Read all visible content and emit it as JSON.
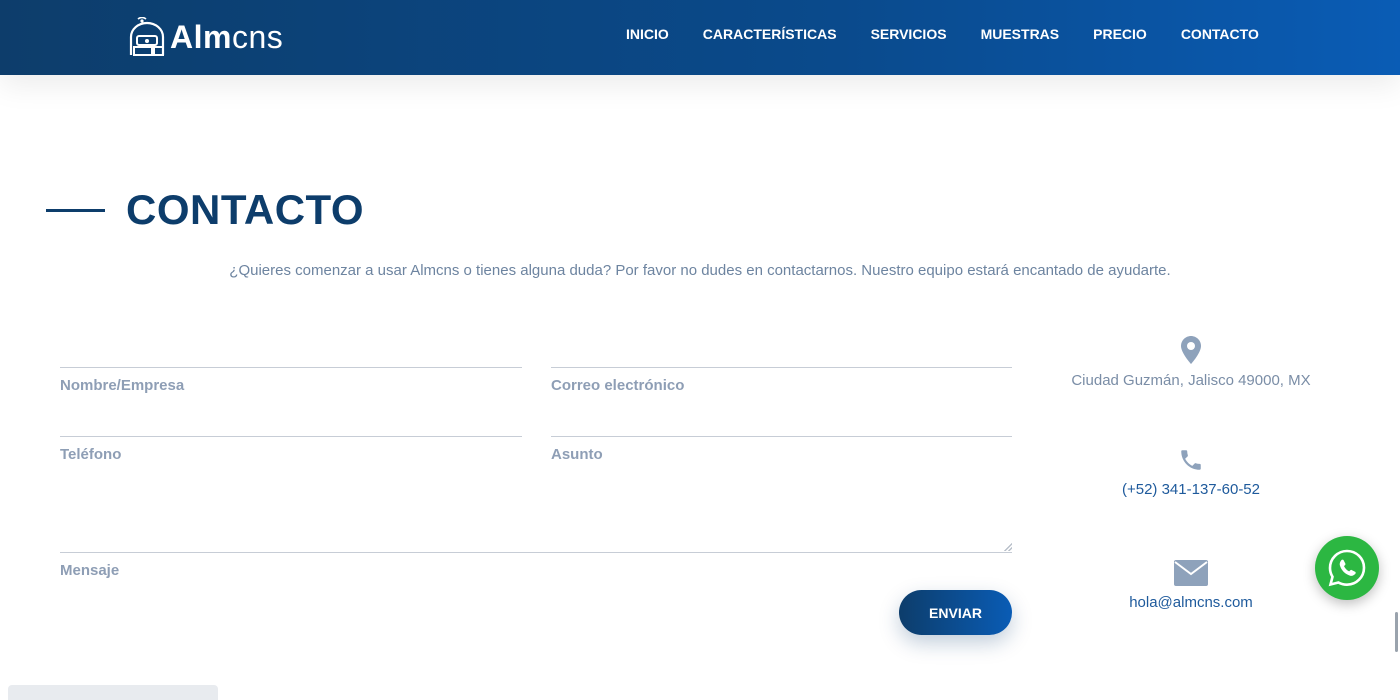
{
  "brand": {
    "logo_bold": "Alm",
    "logo_light": "cns"
  },
  "nav": [
    "INICIO",
    "CARACTERÍSTICAS",
    "SERVICIOS",
    "MUESTRAS",
    "PRECIO",
    "CONTACTO"
  ],
  "section": {
    "title": "CONTACTO",
    "intro": "¿Quieres comenzar a usar Almcns o tienes alguna duda? Por favor no dudes en contactarnos. Nuestro equipo estará encantado de ayudarte."
  },
  "form": {
    "name_label": "Nombre/Empresa",
    "email_label": "Correo electrónico",
    "phone_label": "Teléfono",
    "subject_label": "Asunto",
    "message_label": "Mensaje",
    "submit_label": "ENVIAR"
  },
  "contact_info": {
    "address": "Ciudad Guzmán, Jalisco 49000, MX",
    "phone": "(+52) 341-137-60-52",
    "email": "hola@almcns.com"
  },
  "icons": {
    "location": "map-pin-icon",
    "phone": "phone-icon",
    "email": "envelope-icon",
    "whatsapp": "whatsapp-icon"
  },
  "colors": {
    "primary": "#0d3d6b",
    "accent": "#0a5cb5",
    "muted_text": "#7a8da6",
    "whatsapp": "#2cb742"
  }
}
